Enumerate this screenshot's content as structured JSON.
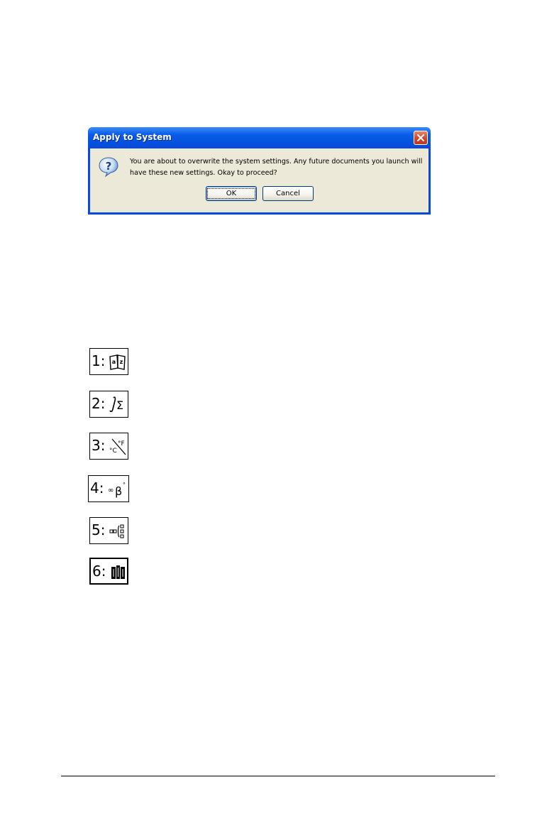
{
  "dialog": {
    "title": "Apply to System",
    "message": "You are about to overwrite the system settings. Any future documents you launch will have these new settings. Okay to proceed?",
    "ok_label": "OK",
    "cancel_label": "Cancel",
    "icon": "question-icon"
  },
  "menu_icons": [
    {
      "number": "1:",
      "icon": "catalog-book-icon"
    },
    {
      "number": "2:",
      "icon": "math-templates-icon"
    },
    {
      "number": "3:",
      "icon": "unit-conversion-icon"
    },
    {
      "number": "4:",
      "icon": "symbols-icon"
    },
    {
      "number": "5:",
      "icon": "math-expression-templates-icon"
    },
    {
      "number": "6:",
      "icon": "libraries-icon"
    }
  ],
  "colors": {
    "titlebar": "#0a5bea",
    "dialog_face": "#ece9d8",
    "close_button": "#d1452a"
  }
}
